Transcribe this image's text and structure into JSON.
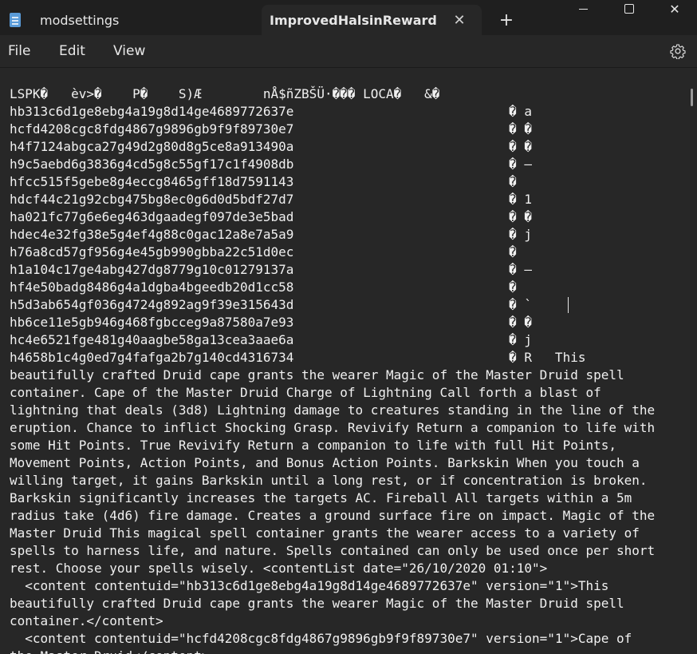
{
  "tabs": [
    {
      "title": "modsettings"
    },
    {
      "title": "ImprovedHalsinReward"
    }
  ],
  "menu": {
    "file": "File",
    "edit": "Edit",
    "view": "View"
  },
  "icons": {
    "notepad": "notepad-icon",
    "close_tab": "close-icon",
    "new_tab": "plus-icon",
    "settings": "gear-icon"
  },
  "editor_text": "LSPK�   èv>�    P�    S)Æ        nÅ$ñZBŠÜ·��� LOCA�   &�\nhb313c6d1ge8ebg4a19g8d14ge4689772637e                            � a\nhcfd4208cgc8fdg4867g9896gb9f9f89730e7                            � �\nh4f7124abgca27g49d2g80d8g5ce8a913490a                            � �\nh9c5aebd6g3836g4cd5g8c55gf17c1f4908db                            � –\nhfcc515f5gebe8g4eccg8465gff18d7591143                            �\nhdcf44c21g92cbg475bg8ec0g6d0d5bdf27d7                            � 1\nha021fc77g6e6eg463dgaadegf097de3e5bad                            � �\nhdec4e32fg38e5g4ef4g88c0gac12a8e7a5a9                            � j\nh76a8cd57gf956g4e45gb990gbba22c51d0ec                            �\nh1a104c17ge4abg427dg8779g10c01279137a                            � –\nhf4e50badg8486g4a1dgba4bgeedb20d1cc58                            �\nh5d3ab654gf036g4724g892ag9f39e315643d                            � `\nhb6ce11e5gb946g468fgbcceg9a87580a7e93                            � �\nhc4e6521fge481g40aagbe58ga13cea3aae6a                            � j\nh4658b1c4g0ed7g4fafga2b7g140cd4316734                            � R   This\nbeautifully crafted Druid cape grants the wearer Magic of the Master Druid spell\ncontainer. Cape of the Master Druid Charge of Lightning Call forth a blast of\nlightning that deals (3d8) Lightning damage to creatures standing in the line of the\neruption. Chance to inflict Shocking Grasp. Revivify Return a companion to life with\nsome Hit Points. True Revivify Return a companion to life with full Hit Points,\nMovement Points, Action Points, and Bonus Action Points. Barkskin When you touch a\nwilling target, it gains Barkskin until a long rest, or if concentration is broken.\nBarkskin significantly increases the targets AC. Fireball All targets within a 5m\nradius take (4d6) fire damage. Creates a ground surface fire on impact. Magic of the\nMaster Druid This magical spell container grants the wearer access to a variety of\nspells to harness life, and nature. Spells contained can only be used once per short\nrest. Choose your spells wisely. <contentList date=\"26/10/2020 01:10\">\n  <content contentuid=\"hb313c6d1ge8ebg4a19g8d14ge4689772637e\" version=\"1\">This\nbeautifully crafted Druid cape grants the wearer Magic of the Master Druid spell\ncontainer.</content>\n  <content contentuid=\"hcfd4208cgc8fdg4867g9896gb9f9f89730e7\" version=\"1\">Cape of\nthe Master Druid</content>"
}
